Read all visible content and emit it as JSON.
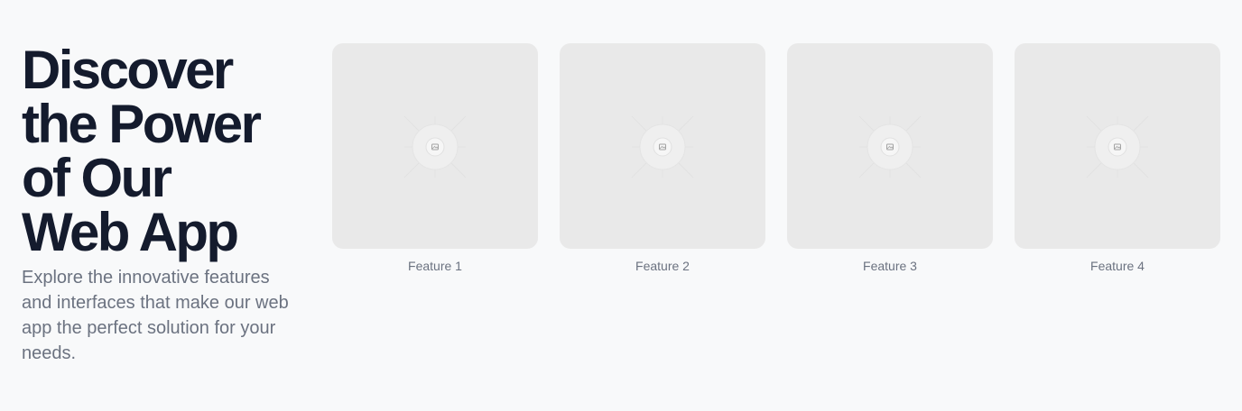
{
  "hero": {
    "headline_lines": [
      "Discover",
      "the Power",
      "of Our",
      "Web App"
    ],
    "subtitle": "Explore the innovative features and interfaces that make our web app the perfect solution for your needs."
  },
  "features": [
    {
      "label": "Feature 1",
      "icon": "image-placeholder-icon"
    },
    {
      "label": "Feature 2",
      "icon": "image-placeholder-icon"
    },
    {
      "label": "Feature 3",
      "icon": "image-placeholder-icon"
    },
    {
      "label": "Feature 4",
      "icon": "image-placeholder-icon"
    }
  ],
  "colors": {
    "background": "#f8f9fa",
    "headline": "#141b2d",
    "muted_text": "#6b7280",
    "placeholder": "#e9e9e9"
  }
}
